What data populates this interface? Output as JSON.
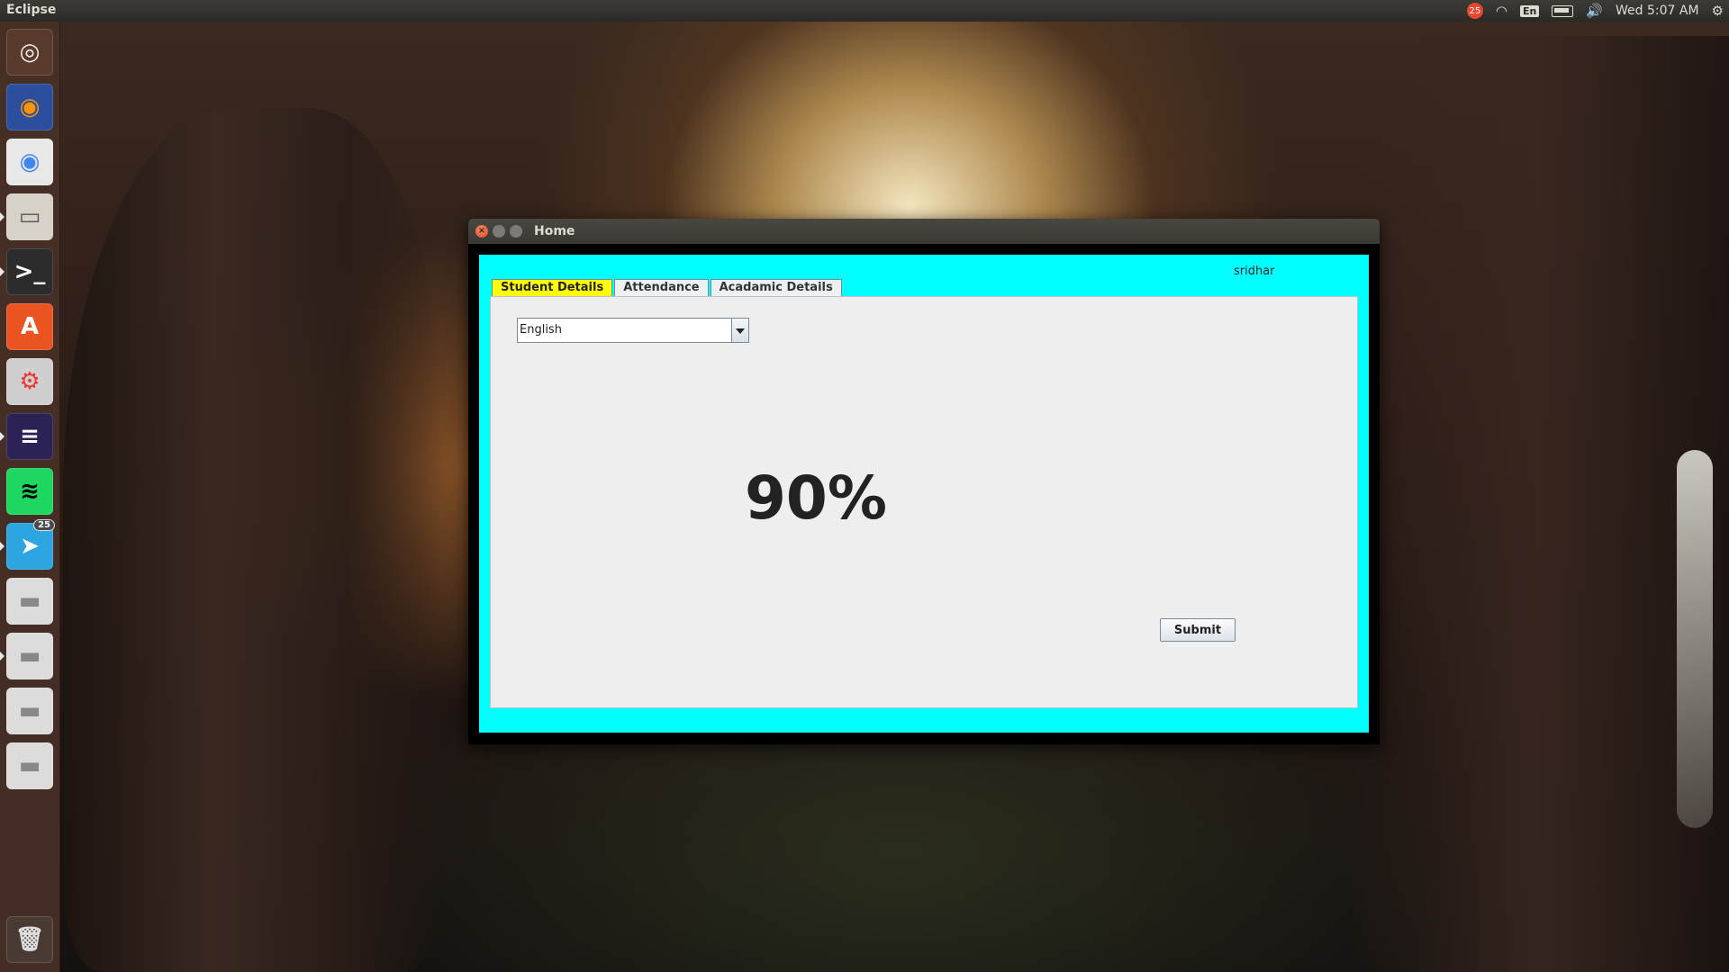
{
  "top_panel": {
    "app_name": "Eclipse",
    "notification_count": "25",
    "keyboard_layout": "En",
    "clock": "Wed  5:07 AM",
    "icons": [
      "notification-icon",
      "wifi-icon",
      "keyboard-layout-icon",
      "battery-icon",
      "volume-icon",
      "settings-gear-icon"
    ]
  },
  "launcher": {
    "items": [
      {
        "name": "ubuntu-dash",
        "glyph": "◎",
        "color": "#f0f0f0",
        "bg": "#5a3a2c"
      },
      {
        "name": "firefox",
        "glyph": "◉",
        "color": "#ff9400",
        "bg": "#2b4f9e"
      },
      {
        "name": "chrome",
        "glyph": "◉",
        "color": "#4285f4",
        "bg": "#e8e8e8"
      },
      {
        "name": "files",
        "glyph": "▭",
        "color": "#555",
        "bg": "#d6d2c8"
      },
      {
        "name": "terminal",
        "glyph": ">_",
        "color": "#fff",
        "bg": "#2c2c2c"
      },
      {
        "name": "software-center",
        "glyph": "A",
        "color": "#fff",
        "bg": "#e95420"
      },
      {
        "name": "system-settings",
        "glyph": "⚙",
        "color": "#e33",
        "bg": "#cfcfcf"
      },
      {
        "name": "eclipse",
        "glyph": "≡",
        "color": "#fff",
        "bg": "#2c2255"
      },
      {
        "name": "spotify",
        "glyph": "≋",
        "color": "#000",
        "bg": "#1ed760"
      },
      {
        "name": "telegram",
        "glyph": "➤",
        "color": "#fff",
        "bg": "#2ca5e0",
        "badge": "25"
      },
      {
        "name": "drive-1",
        "glyph": "▬",
        "color": "#888",
        "bg": "#dcdcdc"
      },
      {
        "name": "drive-2",
        "glyph": "▬",
        "color": "#888",
        "bg": "#dcdcdc"
      },
      {
        "name": "drive-3",
        "glyph": "▬",
        "color": "#888",
        "bg": "#dcdcdc"
      },
      {
        "name": "drive-4",
        "glyph": "▬",
        "color": "#888",
        "bg": "#dcdcdc"
      }
    ],
    "trash": {
      "name": "trash",
      "glyph": "🗑",
      "color": "#ddd",
      "bg": "#4a3a34"
    }
  },
  "window": {
    "title": "Home",
    "username": "sridhar",
    "tabs": [
      {
        "label": "Student Details",
        "active": true
      },
      {
        "label": "Attendance",
        "active": false
      },
      {
        "label": "Acadamic Details",
        "active": false
      }
    ],
    "subject_select": {
      "value": "English"
    },
    "attendance_percent": "90%",
    "submit_label": "Submit"
  },
  "colors": {
    "window_bg": "#00ffff",
    "active_tab": "#ffff00",
    "panel_bg": "#eeeeee"
  }
}
